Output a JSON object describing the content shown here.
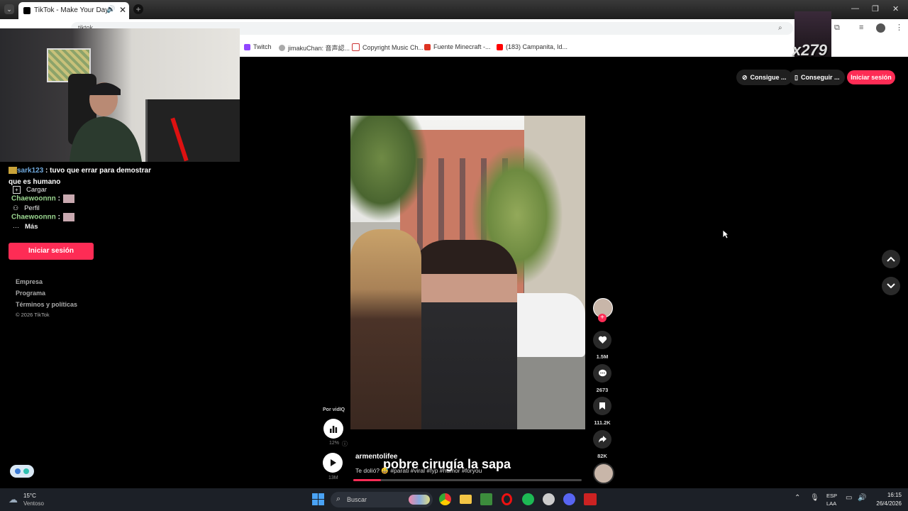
{
  "browser": {
    "tab_title": "TikTok - Make Your Day",
    "address_partial": "tiktok",
    "bookmarks": [
      "Twitch",
      "jimakuChan: 音声認...",
      "Copyright Music Ch...",
      "Fuente Minecraft -...",
      "(183) Campanita, Id..."
    ]
  },
  "stream_overlay": {
    "multiplier": "x279",
    "chat": [
      {
        "user": "sark123",
        "text": ": tuvo que errar para demostrar"
      },
      {
        "user": "",
        "text": "que es humano"
      },
      {
        "user": "Chaewoonnn",
        "text": ":"
      },
      {
        "user": "Chaewoonnn",
        "text": ":"
      }
    ]
  },
  "sidebar": {
    "items": [
      "Cargar",
      "Perfil",
      "Más"
    ],
    "login_label": "Iniciar sesión",
    "footer": [
      "Empresa",
      "Programa",
      "Términos y políticas",
      "© 2026 TikTok"
    ]
  },
  "header": {
    "pill1": "Consigue ...",
    "pill2": "Conseguir ...",
    "login_label": "Iniciar sesión"
  },
  "video": {
    "author": "armentolifee",
    "caption_overlay": "pobre cirugía la sapa",
    "description": "Te dolió? 😅 #parati #viral #fyp #humor #foryou",
    "by_label": "Por vidIQ",
    "progress_pct": "12%",
    "views": "13M",
    "likes": "1.5M",
    "comments": "2673",
    "saves": "111.2K",
    "shares": "82K"
  },
  "taskbar": {
    "temp": "15°C",
    "weather": "Ventoso",
    "search_placeholder": "Buscar",
    "lang1": "ESP",
    "lang2": "LAA",
    "time": "16:15",
    "date": "26/4/2026"
  },
  "colors": {
    "accent": "#fe2c55",
    "chat_name": "#9ad58f"
  }
}
